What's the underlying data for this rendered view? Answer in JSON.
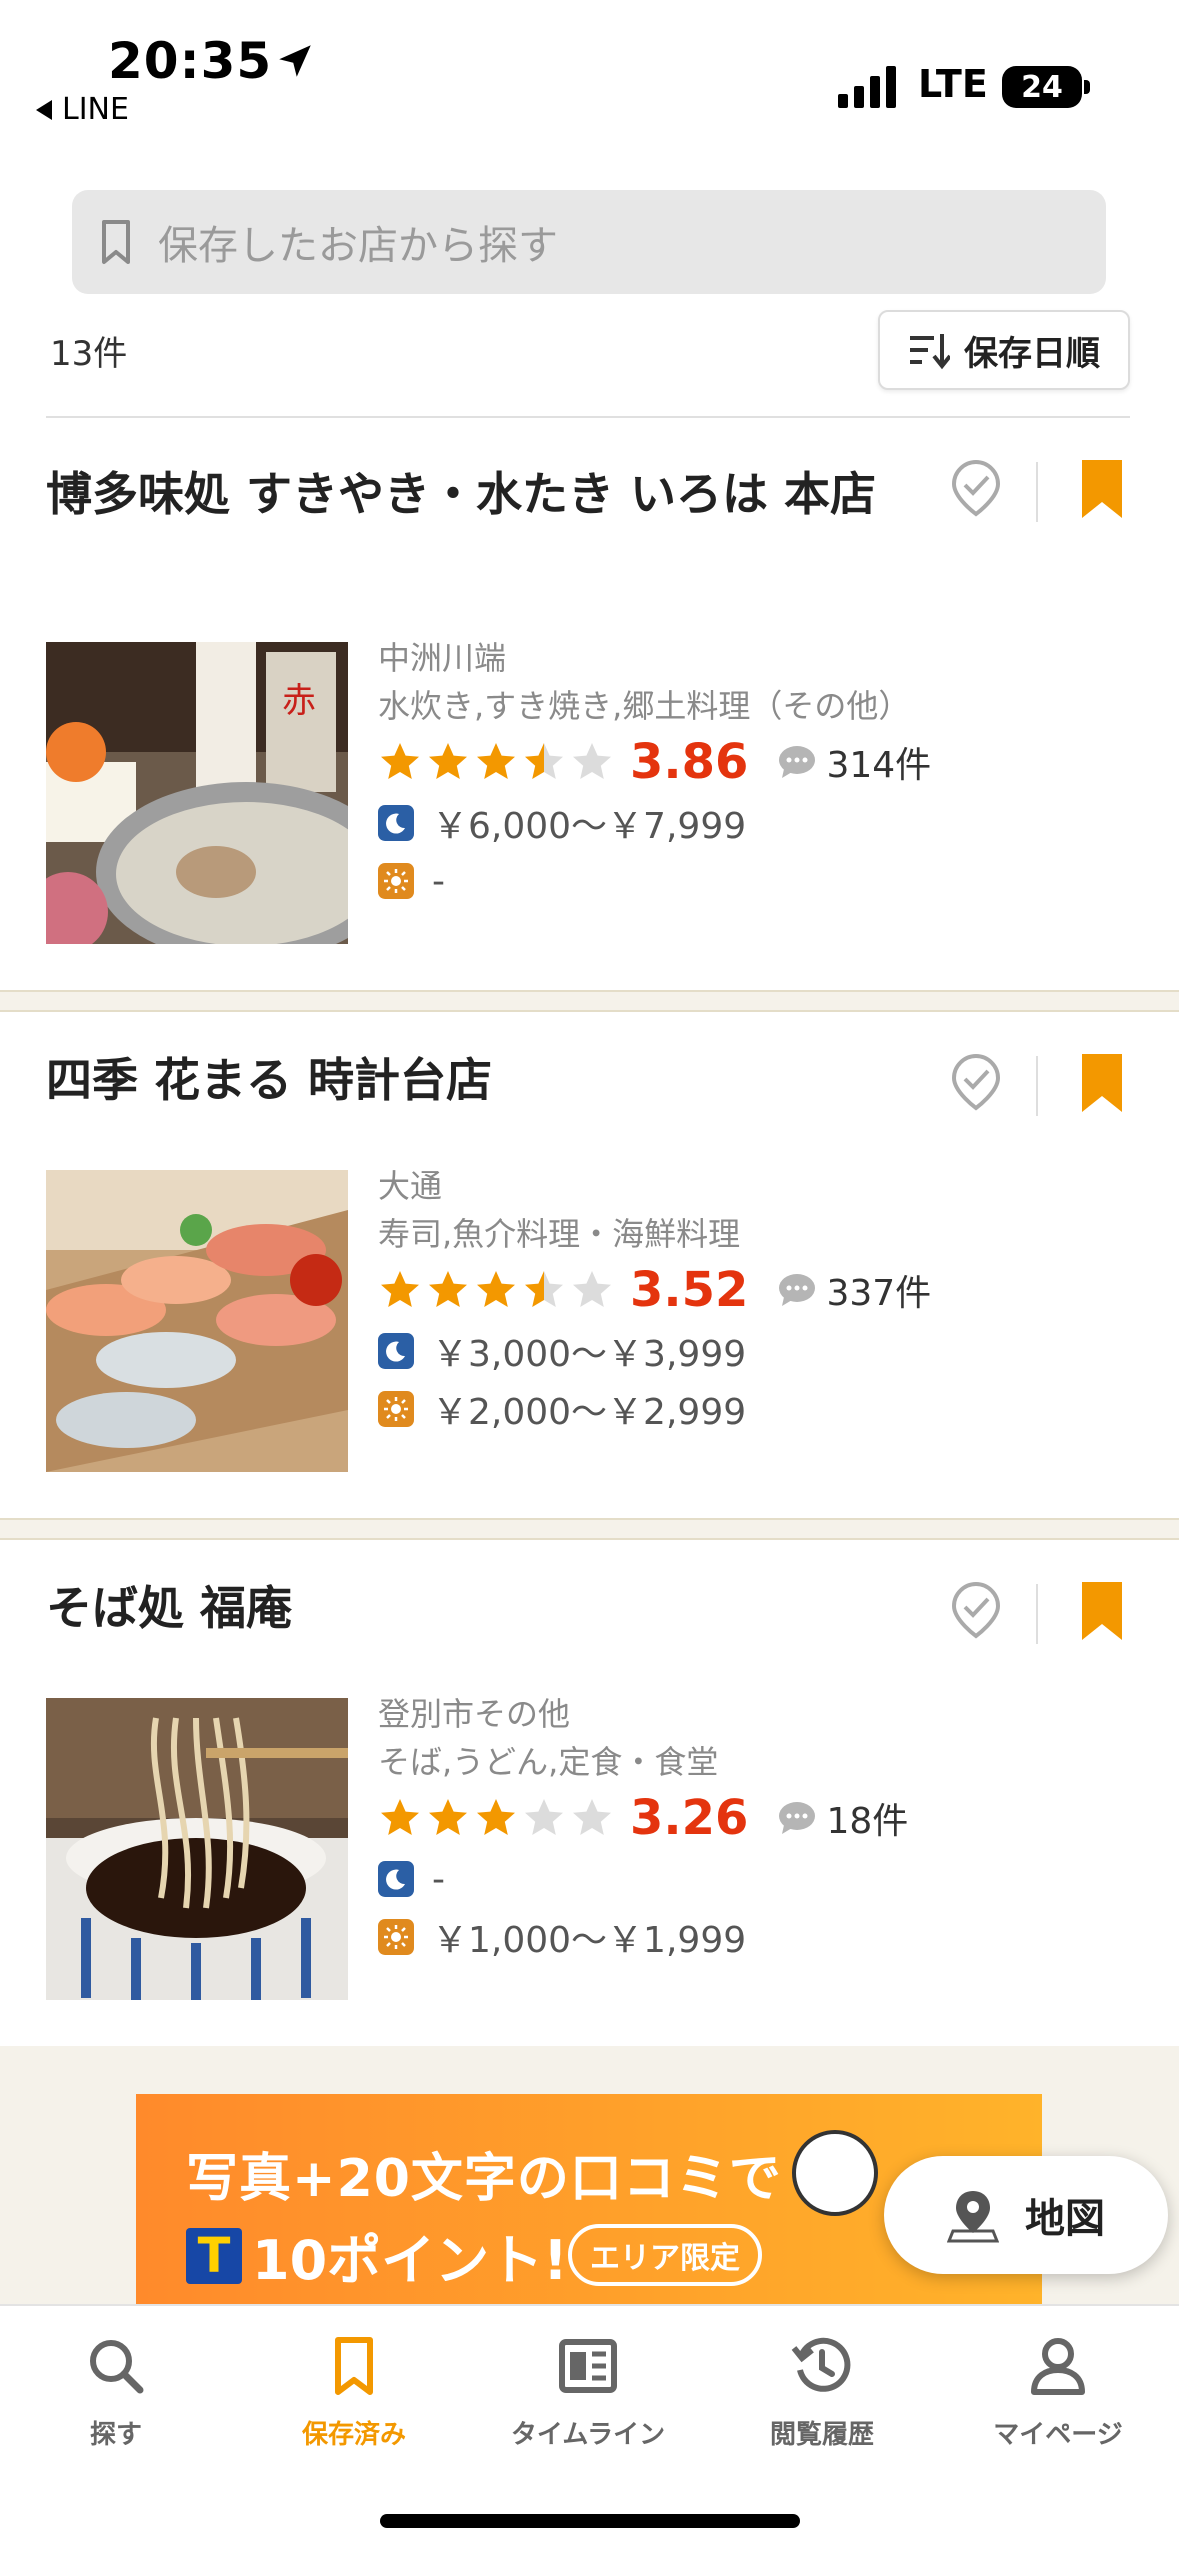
{
  "status_bar": {
    "time": "20:35",
    "back_app": "LINE",
    "network": "LTE",
    "battery": "24"
  },
  "search": {
    "placeholder": "保存したお店から探す"
  },
  "list_header": {
    "count": "13件",
    "sort_label": "保存日順"
  },
  "restaurants": [
    {
      "name": "博多味処 すきやき・水たき いろは 本店",
      "area": "中洲川端",
      "genre": "水炊き,すき焼き,郷土料理（その他）",
      "rating": "3.86",
      "rating_value": 3.5,
      "reviews": "314件",
      "dinner_price": "￥6,000～￥7,999",
      "lunch_price": "-",
      "saved": true
    },
    {
      "name": "四季 花まる 時計台店",
      "area": "大通",
      "genre": "寿司,魚介料理・海鮮料理",
      "rating": "3.52",
      "rating_value": 3.5,
      "reviews": "337件",
      "dinner_price": "￥3,000～￥3,999",
      "lunch_price": "￥2,000～￥2,999",
      "saved": true
    },
    {
      "name": "そば処 福庵",
      "area": "登別市その他",
      "genre": "そば,うどん,定食・食堂",
      "rating": "3.26",
      "rating_value": 3,
      "reviews": "18件",
      "dinner_price": "-",
      "lunch_price": "￥1,000～￥1,999",
      "saved": true
    }
  ],
  "banner": {
    "line1": "写真+20文字の口コミで",
    "line2": "10ポイント!",
    "t_mark": "T",
    "badge": "エリア限定"
  },
  "map_button": {
    "label": "地図"
  },
  "tabs": [
    {
      "label": "探す",
      "icon": "search-icon",
      "active": false
    },
    {
      "label": "保存済み",
      "icon": "bookmark-icon",
      "active": true
    },
    {
      "label": "タイムライン",
      "icon": "timeline-icon",
      "active": false
    },
    {
      "label": "閲覧履歴",
      "icon": "history-icon",
      "active": false
    },
    {
      "label": "マイページ",
      "icon": "person-icon",
      "active": false
    }
  ],
  "colors": {
    "accent": "#f39800",
    "score": "#e4340e",
    "star": "#f39800"
  }
}
